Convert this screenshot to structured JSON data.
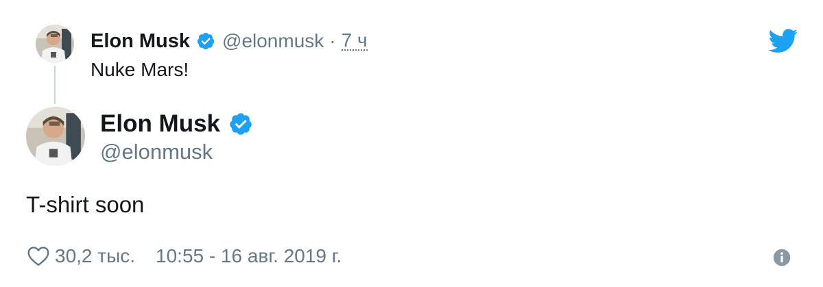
{
  "parent_tweet": {
    "author_name": "Elon Musk",
    "handle": "@elonmusk",
    "separator": "·",
    "relative_time": "7 ч",
    "text": "Nuke Mars!"
  },
  "main_tweet": {
    "author_name": "Elon Musk",
    "handle": "@elonmusk",
    "text": "T-shirt soon"
  },
  "footer": {
    "like_count": "30,2 тыс.",
    "timestamp": "10:55 - 16 авг. 2019 г."
  },
  "icons": {
    "verified": "verified-badge-icon",
    "twitter": "twitter-bird-icon",
    "like": "heart-icon",
    "info": "info-icon"
  },
  "colors": {
    "twitter_blue": "#1da1f2",
    "secondary_text": "#657786",
    "primary_text": "#14171a",
    "thread_line": "#ccd6dd"
  }
}
